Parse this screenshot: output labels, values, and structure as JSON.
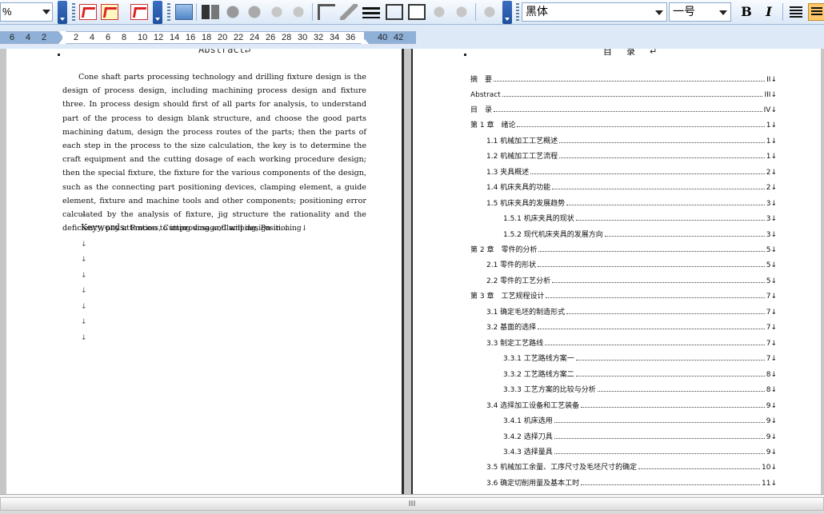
{
  "toolbar": {
    "zoom_value": "%",
    "font_name": "黑体",
    "font_size": "一号",
    "bold_label": "B",
    "italic_label": "I"
  },
  "ruler": {
    "ticks": [
      "6",
      "4",
      "2",
      "2",
      "4",
      "6",
      "8",
      "10",
      "12",
      "14",
      "16",
      "18",
      "20",
      "22",
      "24",
      "26",
      "28",
      "30",
      "32",
      "34",
      "36",
      "40",
      "42"
    ]
  },
  "left_page": {
    "title": "Abstract↵",
    "body": "Cone shaft parts processing technology and drilling fixture design is the design of process design, including machining process design and fixture three. In process design should first of all parts for analysis, to understand part of the process to design blank structure, and choose the good parts machining datum, design the process routes of the parts; then the parts of each step in the process to the size calculation, the key is to determine the craft equipment and the cutting dosage of each working procedure design; then the special fixture, the fixture for the various components of the design, such as the connecting part positioning devices, clamping element, a guide element, fixture and machine tools and other components; positioning error calculated by the analysis of fixture, jig structure the rationality and the deficiency, pay attention to improving and will design in.↓",
    "keywords_label": "Keywords:",
    "keywords_value": "Process, Cutting dosage,Clamping, Positioning↓",
    "para_mark": "↓"
  },
  "right_page": {
    "toc_title": "目录↵",
    "entries": [
      {
        "label": "摘　要",
        "page": "II↓"
      },
      {
        "label": "Abstract",
        "page": "III↓"
      },
      {
        "label": "目　录",
        "page": "IV↓"
      },
      {
        "label": "第 1 章　绪论",
        "page": "1↓"
      },
      {
        "label": "1.1  机械加工工艺概述",
        "page": "1↓"
      },
      {
        "label": "1.2 机械加工工艺流程",
        "page": "1↓"
      },
      {
        "label": "1.3 夹具概述",
        "page": "2↓"
      },
      {
        "label": "1.4 机床夹具的功能",
        "page": "2↓"
      },
      {
        "label": "1.5 机床夹具的发展趋势",
        "page": "3↓"
      },
      {
        "label": "1.5.1 机床夹具的现状",
        "page": "3↓"
      },
      {
        "label": "1.5.2  现代机床夹具的发展方向",
        "page": "3↓"
      },
      {
        "label": "第 2 章　零件的分析",
        "page": "5↓"
      },
      {
        "label": "2.1 零件的形状",
        "page": "5↓"
      },
      {
        "label": "2.2 零件的工艺分析",
        "page": "5↓"
      },
      {
        "label": "第 3 章　工艺规程设计",
        "page": "7↓"
      },
      {
        "label": "3.1  确定毛坯的制造形式",
        "page": "7↓"
      },
      {
        "label": "3.2  基面的选择",
        "page": "7↓"
      },
      {
        "label": "3.3  制定工艺路线",
        "page": "7↓"
      },
      {
        "label": "3.3.1  工艺路线方案一",
        "page": "7↓"
      },
      {
        "label": "3.3.2  工艺路线方案二",
        "page": "8↓"
      },
      {
        "label": "3.3.3  工艺方案的比较与分析",
        "page": "8↓"
      },
      {
        "label": "3.4  选择加工设备和工艺装备",
        "page": "9↓"
      },
      {
        "label": "3.4.1  机床选用",
        "page": "9↓"
      },
      {
        "label": "3.4.2  选择刀具",
        "page": "9↓"
      },
      {
        "label": "3.4.3  选择量具",
        "page": "9↓"
      },
      {
        "label": "3.5  机械加工余量、工序尺寸及毛坯尺寸的确定",
        "page": "10↓"
      },
      {
        "label": "3.6 确定切削用量及基本工时",
        "page": "11↓"
      }
    ]
  },
  "scrollbar": {
    "grip": "III"
  }
}
